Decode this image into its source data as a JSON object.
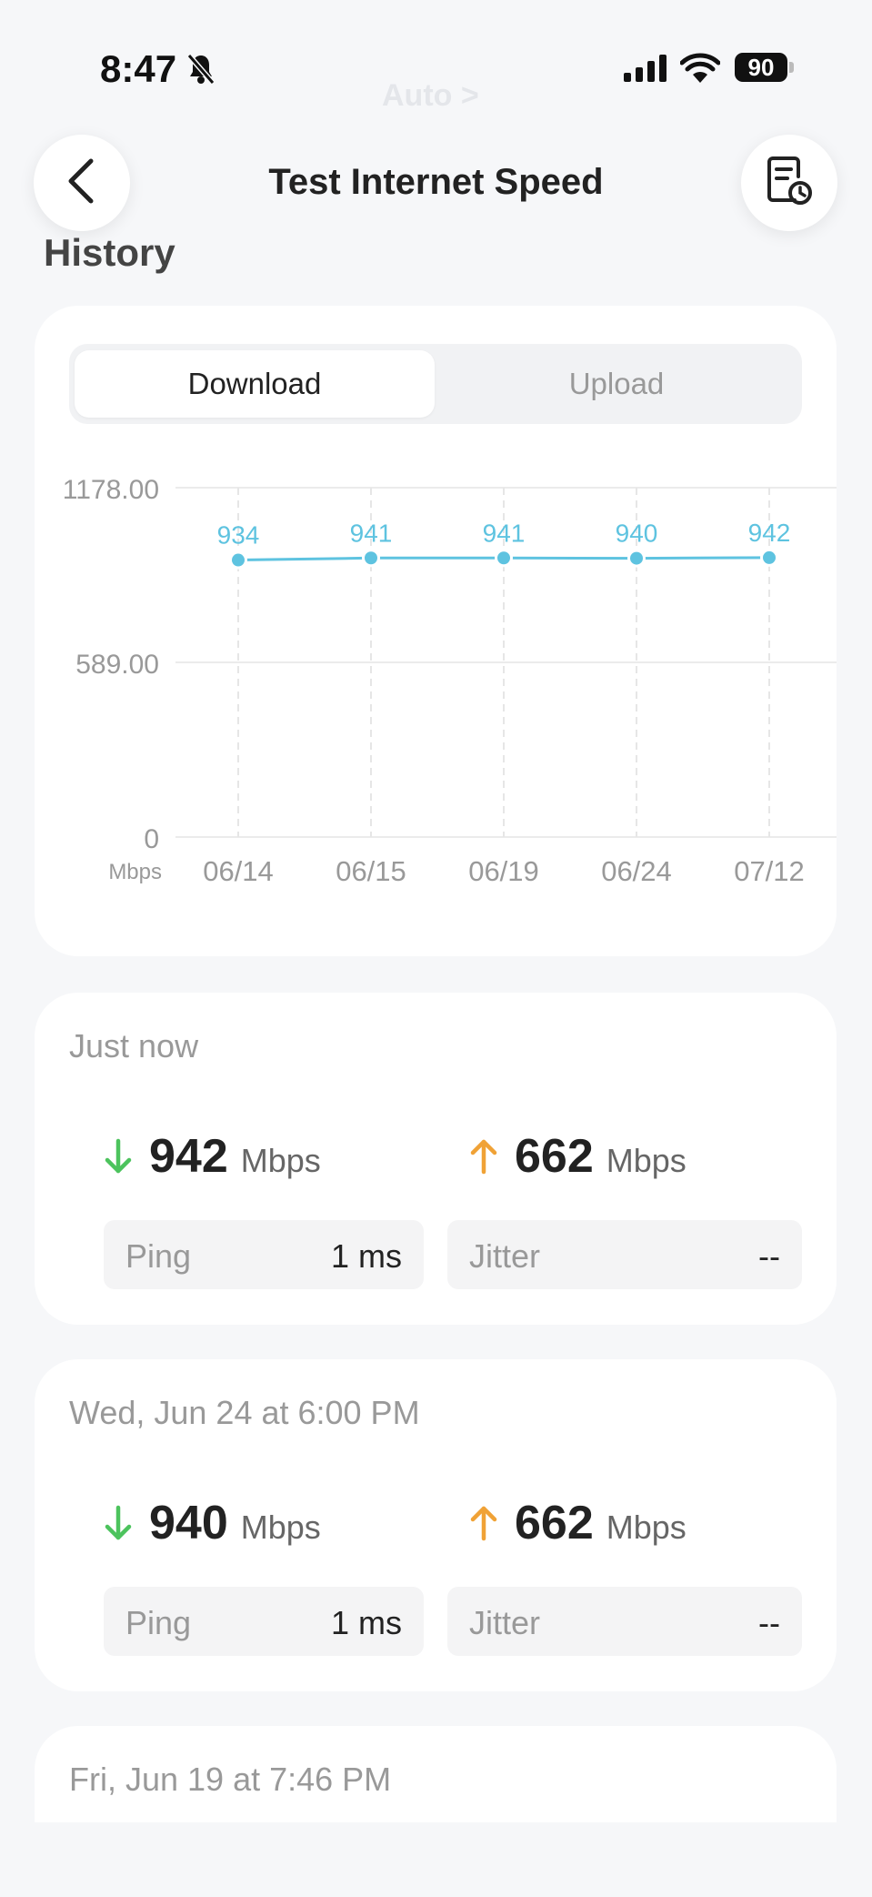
{
  "status_bar": {
    "time": "8:47",
    "battery": "90"
  },
  "ghost_text": "Auto >",
  "nav": {
    "title": "Test Internet Speed"
  },
  "section_title": "History",
  "tabs": [
    {
      "label": "Download",
      "selected": true
    },
    {
      "label": "Upload",
      "selected": false
    }
  ],
  "chart_data": {
    "type": "line",
    "categories": [
      "06/14",
      "06/15",
      "06/19",
      "06/24",
      "07/12"
    ],
    "values": [
      934,
      941,
      941,
      940,
      942
    ],
    "data_labels": [
      "934",
      "941",
      "941",
      "940",
      "942"
    ],
    "y_ticks": [
      "1178.00",
      "589.00",
      "0"
    ],
    "ylim": [
      0,
      1178
    ],
    "ylabel": "Mbps",
    "color": "#5ec3e0",
    "grid": true
  },
  "results": [
    {
      "date": "Just now",
      "download": "942",
      "upload": "662",
      "unit": "Mbps",
      "ping_label": "Ping",
      "ping": "1 ms",
      "jitter_label": "Jitter",
      "jitter": "--"
    },
    {
      "date": "Wed, Jun 24 at 6:00 PM",
      "download": "940",
      "upload": "662",
      "unit": "Mbps",
      "ping_label": "Ping",
      "ping": "1 ms",
      "jitter_label": "Jitter",
      "jitter": "--"
    },
    {
      "date": "Fri, Jun 19 at 7:46 PM"
    }
  ],
  "colors": {
    "download_arrow": "#4cc35d",
    "upload_arrow": "#f0a236",
    "chart_line": "#5ec3e0"
  }
}
